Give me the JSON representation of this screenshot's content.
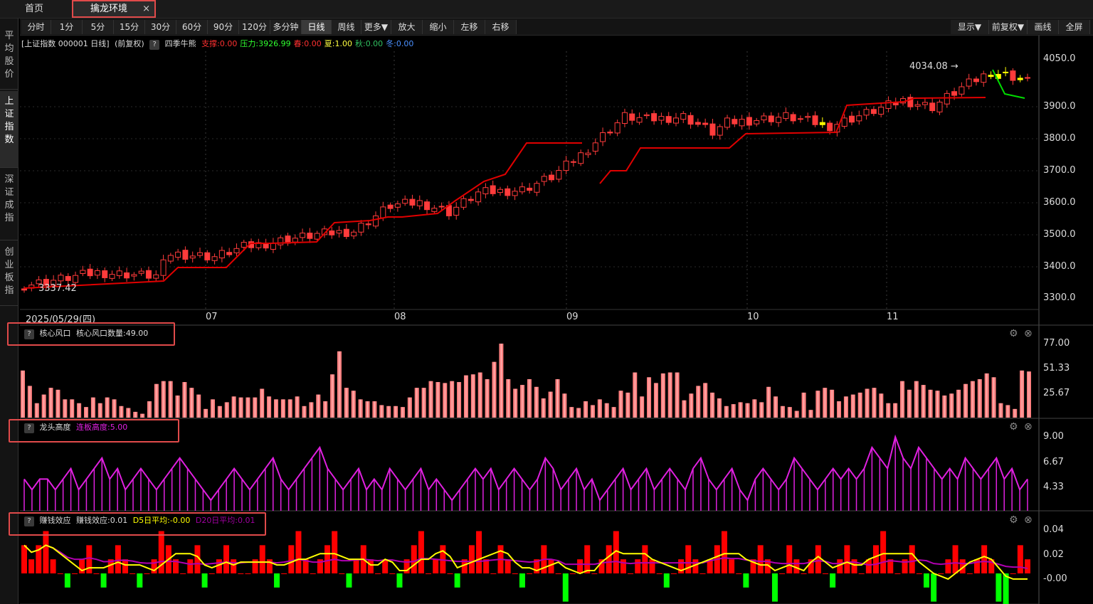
{
  "tabs": {
    "home": "首页",
    "active": "擒龙环境",
    "close": "×"
  },
  "toolbar": {
    "periods": [
      "分时",
      "1分",
      "5分",
      "15分",
      "30分",
      "60分",
      "90分",
      "120分",
      "多分钟",
      "日线",
      "周线",
      "更多▼",
      "放大",
      "缩小",
      "左移",
      "右移"
    ],
    "selected": "日线",
    "right": [
      "显示▼",
      "前复权▼",
      "画线",
      "全屏"
    ]
  },
  "sidebar": {
    "items": [
      "平均股价",
      "上证指数",
      "深证成指",
      "创业板指"
    ],
    "active": 1
  },
  "main_chart": {
    "title": "[上证指数 000001 日线]",
    "adjust": "(前复权)",
    "indicator": "四季牛熊",
    "fields": [
      {
        "label": "支撑:0.00",
        "color": "#ff3030"
      },
      {
        "label": "压力:3926.99",
        "color": "#30ff30"
      },
      {
        "label": "春:0.00",
        "color": "#ff3030"
      },
      {
        "label": "夏:1.00",
        "color": "#ffff40"
      },
      {
        "label": "秋:0.00",
        "color": "#30c060"
      },
      {
        "label": "冬:0.00",
        "color": "#4a90ff"
      }
    ],
    "high_label": "4034.08",
    "low_label": "3337.42",
    "y_ticks": [
      "4050.0",
      "3900.0",
      "3800.0",
      "3700.0",
      "3600.0",
      "3500.0",
      "3400.0",
      "3300.0"
    ],
    "dates": [
      "2025/05/29(四)",
      "07",
      "08",
      "09",
      "10",
      "11"
    ]
  },
  "panel1": {
    "name": "核心风口",
    "value_label": "核心风口数量:49.00",
    "y_ticks": [
      "77.00",
      "51.33",
      "25.67"
    ]
  },
  "panel2": {
    "name": "龙头高度",
    "value_label": "连板高度:5.00",
    "y_ticks": [
      "9.00",
      "6.67",
      "4.33"
    ]
  },
  "panel3": {
    "name": "赚钱效应",
    "value_label": "赚钱效应:0.01",
    "d5": "D5日平均:-0.00",
    "d20": "D20日平均:0.01",
    "y_ticks": [
      "0.04",
      "0.02",
      "-0.00"
    ]
  },
  "colors": {
    "up": "#ff3b3b",
    "down_yellow": "#ffff00",
    "support": "#e00000",
    "resist": "#00dd00",
    "bar1": "#ff8080",
    "panel2": "#e020e0",
    "pos": "#ff0000",
    "neg": "#00ff00",
    "d5": "#ffff00",
    "d20": "#b000b0"
  },
  "chart_data": {
    "type": "bar",
    "title": "",
    "index_close_range": [
      3337.42,
      4034.08
    ],
    "panel1_values": [
      49,
      33,
      15,
      24,
      31,
      29,
      19,
      19,
      15,
      11,
      21,
      15,
      21,
      19,
      12,
      10,
      6,
      4,
      17,
      35,
      38,
      38,
      23,
      37,
      31,
      24,
      9,
      19,
      12,
      16,
      22,
      21,
      21,
      21,
      30,
      22,
      19,
      19,
      19,
      22,
      12,
      16,
      24,
      17,
      45,
      69,
      31,
      28,
      19,
      17,
      17,
      13,
      12,
      12,
      11,
      21,
      31,
      31,
      38,
      37,
      36,
      38,
      37,
      44,
      45,
      47,
      40,
      58,
      77,
      40,
      30,
      34,
      40,
      32,
      20,
      27,
      40,
      25,
      11,
      10,
      17,
      13,
      19,
      15,
      11,
      28,
      26,
      47,
      22,
      42,
      36,
      46,
      47,
      47,
      18,
      25,
      33,
      36,
      26,
      20,
      12,
      14,
      16,
      15,
      19,
      16,
      32,
      22,
      12,
      11,
      7,
      26,
      8,
      28,
      31,
      29,
      17,
      22,
      24,
      26,
      30,
      31,
      25,
      15,
      15,
      38,
      29,
      38,
      34,
      29,
      28,
      23,
      25,
      29,
      35,
      38,
      40,
      46,
      42,
      15,
      13,
      9,
      49,
      48
    ],
    "panel2_values": [
      5,
      4,
      5,
      5,
      4,
      5,
      6,
      4,
      5,
      6,
      7,
      5,
      6,
      4,
      5,
      6,
      5,
      4,
      5,
      6,
      7,
      6,
      5,
      4,
      3,
      4,
      5,
      6,
      5,
      4,
      5,
      6,
      7,
      5,
      4,
      5,
      6,
      7,
      8,
      6,
      5,
      4,
      5,
      6,
      4,
      5,
      4,
      6,
      5,
      4,
      5,
      6,
      4,
      5,
      4,
      3,
      4,
      5,
      6,
      5,
      6,
      4,
      5,
      6,
      5,
      4,
      5,
      7,
      6,
      4,
      5,
      6,
      4,
      5,
      3,
      4,
      5,
      6,
      4,
      5,
      6,
      4,
      5,
      6,
      5,
      4,
      6,
      7,
      5,
      4,
      5,
      6,
      4,
      3,
      5,
      6,
      5,
      4,
      5,
      7,
      6,
      5,
      4,
      5,
      6,
      5,
      6,
      5,
      6,
      8,
      7,
      6,
      9,
      7,
      6,
      8,
      7,
      6,
      5,
      6,
      5,
      7,
      6,
      5,
      6,
      7,
      5,
      6,
      4,
      5
    ],
    "panel3_values": [
      0.02,
      0.01,
      0.02,
      0.03,
      0.01,
      0.0,
      -0.01,
      0.0,
      0.01,
      0.02,
      0.0,
      -0.01,
      0.01,
      0.02,
      0.01,
      0.0,
      -0.01,
      0.0,
      0.01,
      0.03,
      0.02,
      0.01,
      0.0,
      0.01,
      0.02,
      -0.01,
      0.0,
      0.01,
      0.02,
      0.01,
      0.0,
      0.0,
      0.01,
      0.02,
      0.01,
      -0.01,
      0.0,
      0.02,
      0.03,
      0.01,
      0.0,
      0.01,
      0.02,
      0.03,
      0.0,
      -0.01,
      0.01,
      0.02,
      0.01,
      0.0,
      0.01,
      0.0,
      -0.01,
      0.01,
      0.02,
      0.03,
      0.0,
      0.01,
      0.02,
      0.0,
      -0.01,
      0.01,
      0.02,
      0.03,
      0.01,
      0.0,
      0.02,
      0.01,
      0.0,
      -0.01,
      0.0,
      0.01,
      0.02,
      0.01,
      0.0,
      -0.02,
      0.0,
      0.01,
      0.02,
      0.0,
      0.01,
      0.02,
      0.03,
      0.01,
      0.0,
      0.01,
      0.02,
      0.01,
      0.0,
      -0.01,
      0.0,
      0.01,
      0.02,
      0.01,
      0.0,
      0.01,
      0.02,
      0.03,
      0.01,
      0.0,
      -0.01,
      0.01,
      0.02,
      0.01,
      -0.02,
      0.0,
      0.02,
      0.01,
      0.0,
      0.01,
      0.02,
      0.0,
      -0.01,
      0.01,
      0.02,
      0.01,
      0.0,
      0.01,
      0.02,
      0.03,
      0.01,
      0.0,
      0.01,
      0.02,
      0.0,
      -0.01,
      -0.02,
      0.0,
      0.01,
      0.02,
      0.01,
      0.0,
      0.01,
      0.02,
      0.01,
      -0.02,
      -0.03,
      0.0,
      0.02,
      0.01
    ]
  }
}
